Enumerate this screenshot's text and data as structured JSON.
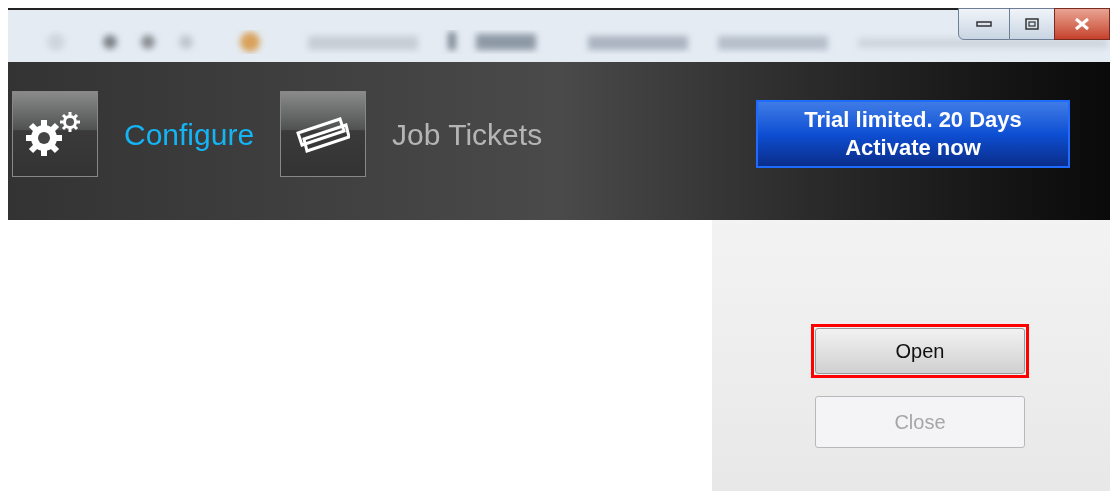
{
  "tabs": [
    {
      "label": "Configure",
      "kind": "gears",
      "selected": true
    },
    {
      "label": "Job Tickets",
      "kind": "ticket",
      "selected": false
    }
  ],
  "trial_button": {
    "lines": [
      "Trial limited. 20 Days",
      "Activate now"
    ]
  },
  "buttons": [
    {
      "label": "Open",
      "disabled": false,
      "highlighted": true
    },
    {
      "label": "Close",
      "disabled": true,
      "highlighted": false
    }
  ]
}
